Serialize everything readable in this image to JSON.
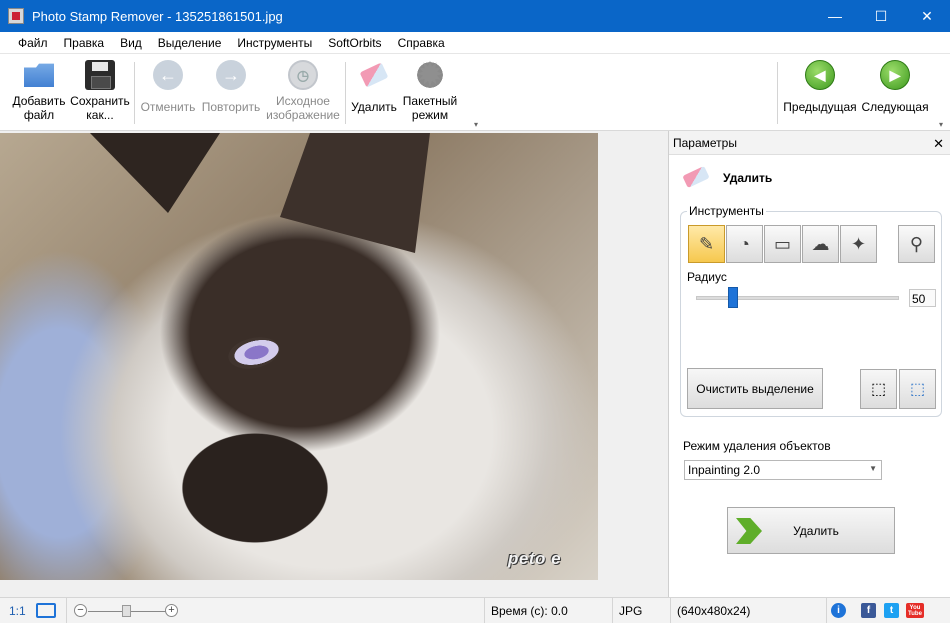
{
  "window": {
    "title": "Photo Stamp Remover - 135251861501.jpg",
    "controls": {
      "minimize": "—",
      "maximize": "☐",
      "close": "✕"
    }
  },
  "menu": [
    "Файл",
    "Правка",
    "Вид",
    "Выделение",
    "Инструменты",
    "SoftOrbits",
    "Справка"
  ],
  "toolbar": {
    "add_file": "Добавить файл",
    "save_as": "Сохранить как...",
    "undo": "Отменить",
    "redo": "Повторить",
    "original": "Исходное изображение",
    "remove": "Удалить",
    "batch": "Пакетный режим",
    "prev": "Предыдущая",
    "next": "Следующая"
  },
  "image": {
    "watermark": "peto e"
  },
  "panel": {
    "header": "Параметры",
    "section_title": "Удалить",
    "tools_legend": "Инструменты",
    "radius_label": "Радиус",
    "radius_value": "50",
    "radius_fraction": 0.18,
    "clear_selection": "Очистить выделение",
    "mode_label": "Режим удаления объектов",
    "mode_value": "Inpainting 2.0",
    "remove_button": "Удалить"
  },
  "status": {
    "ratio": "1:1",
    "time": "Время (с): 0.0",
    "format": "JPG",
    "dimensions": "(640x480x24)",
    "youtube": "You Tube"
  },
  "colors": {
    "titlebar": "#0a66c8",
    "slider_thumb": "#1e73d8",
    "active_tool": "#f6c84e"
  }
}
